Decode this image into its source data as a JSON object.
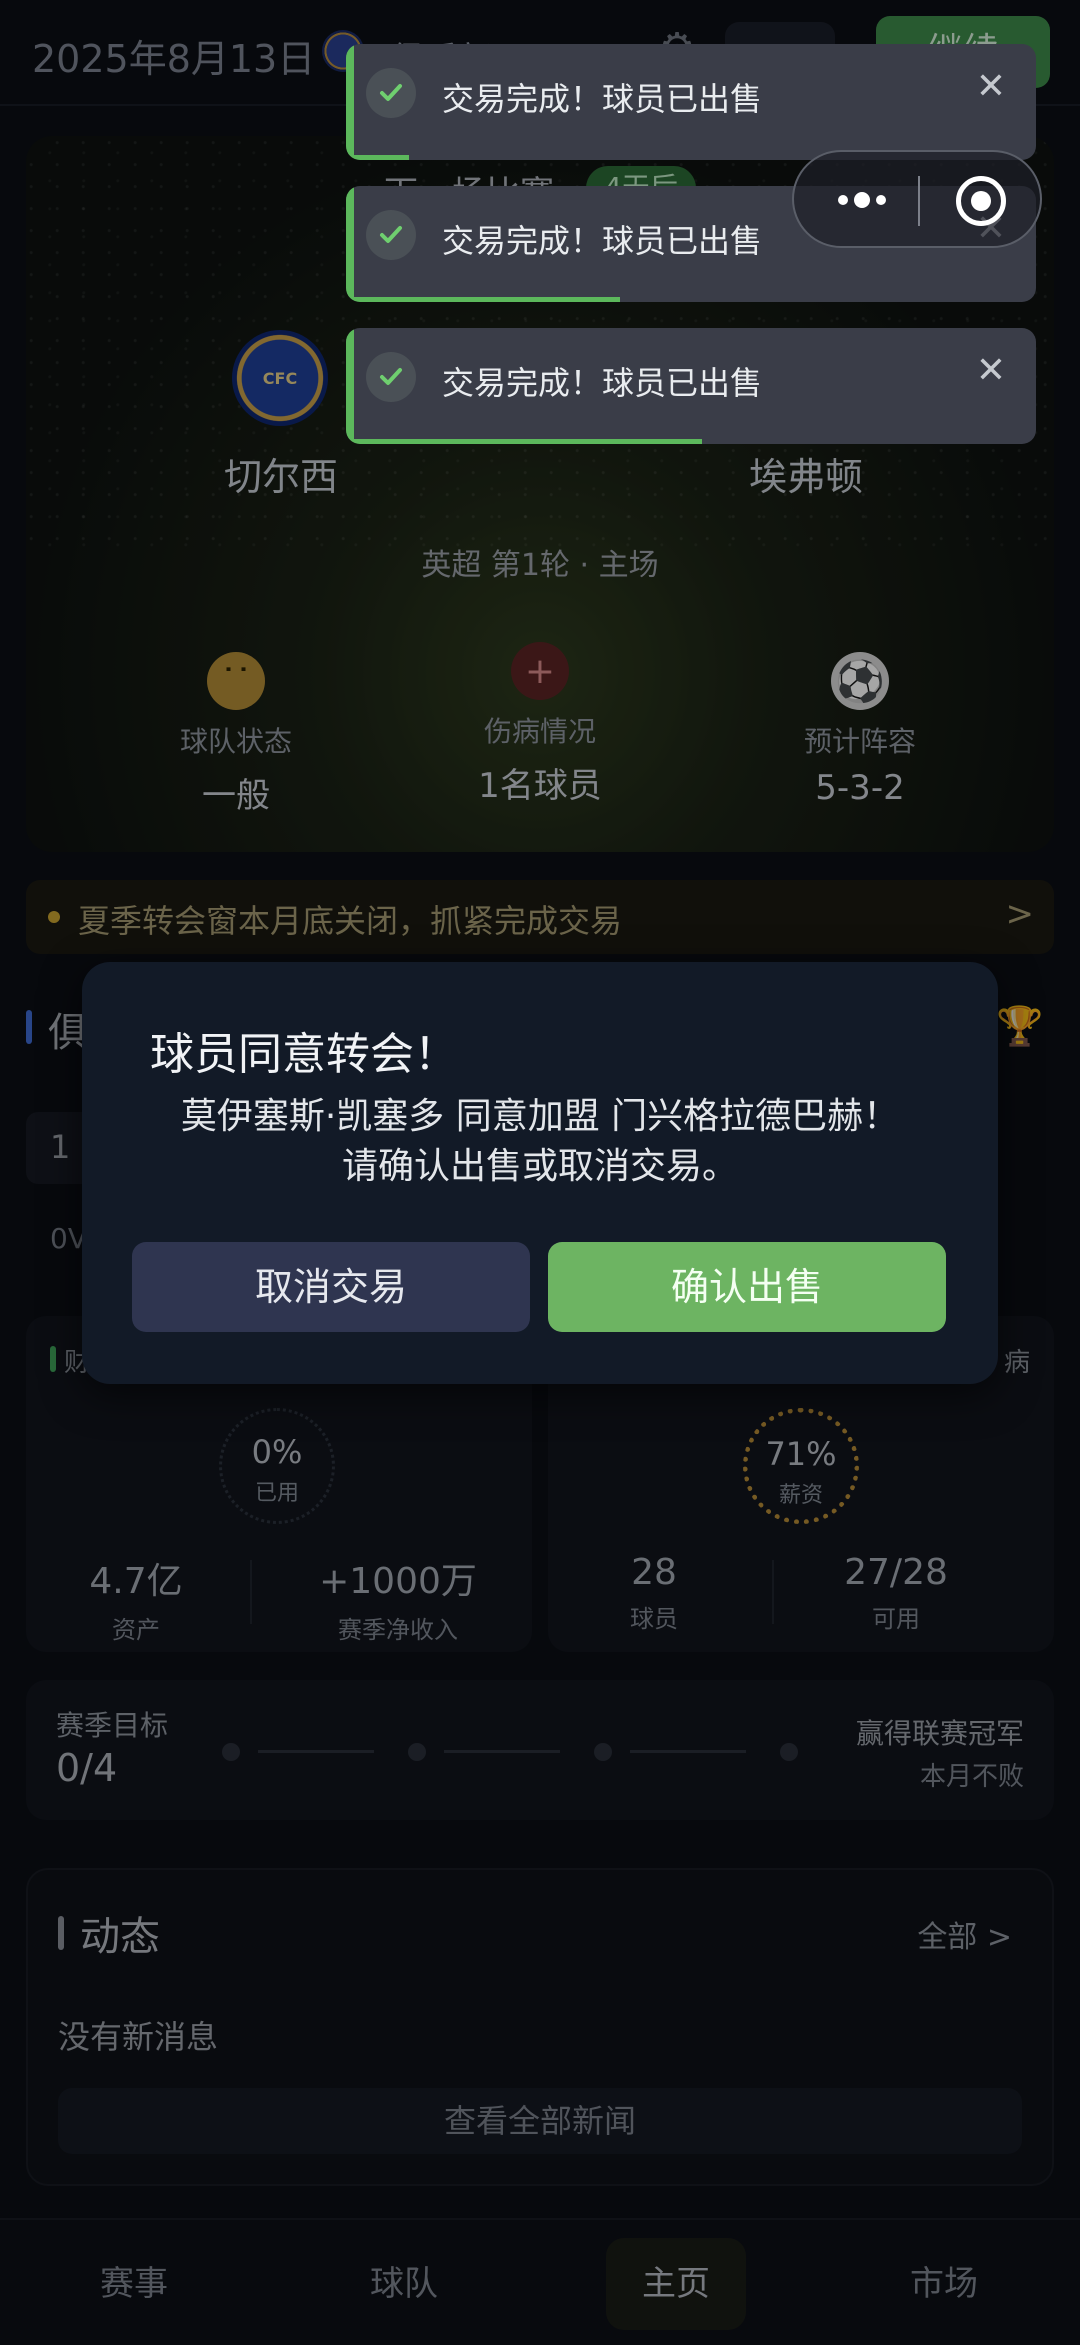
{
  "topbar": {
    "date": "2025年8月13日",
    "club_name": "俱乐部",
    "continue_label": "继续"
  },
  "match": {
    "next_label": "下一场比赛",
    "days_badge": "4天后",
    "home_team": "切尔西",
    "away_team": "埃弗顿",
    "info": "英超 第1轮  ·  主场",
    "stats": [
      {
        "icon": "neutral-face-icon",
        "label": "球队状态",
        "value": "一般"
      },
      {
        "icon": "injury-plus-icon",
        "label": "伤病情况",
        "value": "1名球员"
      },
      {
        "icon": "soccer-ball-icon",
        "label": "预计阵容",
        "value": "5-3-2"
      }
    ]
  },
  "notice": {
    "text": "夏季转会窗本月底关闭，抓紧完成交易",
    "chevron": ">"
  },
  "club_section": {
    "title_fragment": "俱",
    "row_fragment": "1",
    "ov_fragment": "0V"
  },
  "finance": {
    "title_fragment": "财",
    "ring_pct": "0%",
    "ring_caption": "已用",
    "metrics": [
      {
        "value": "4.7亿",
        "label": "资产"
      },
      {
        "value": "+1000万",
        "label": "赛季净收入"
      }
    ]
  },
  "squad": {
    "title_fragment": "病",
    "ring_pct": "71%",
    "ring_caption": "薪资",
    "metrics": [
      {
        "value": "28",
        "label": "球员"
      },
      {
        "value": "27/28",
        "label": "可用"
      }
    ]
  },
  "goals": {
    "label": "赛季目标",
    "value": "0/4",
    "right_primary": "赢得联赛冠军",
    "right_secondary": "本月不败"
  },
  "news": {
    "title": "动态",
    "all_link": "全部 >",
    "empty_text": "没有新消息",
    "view_all": "查看全部新闻"
  },
  "bottom_nav": [
    {
      "label": "赛事",
      "active": false
    },
    {
      "label": "球队",
      "active": false
    },
    {
      "label": "主页",
      "active": true
    },
    {
      "label": "市场",
      "active": false
    }
  ],
  "toasts": [
    {
      "message": "交易完成！球员已出售",
      "close": "✕",
      "progress": 0.08
    },
    {
      "message": "交易完成！球员已出售",
      "close": "✕",
      "progress": 0.39
    },
    {
      "message": "交易完成！球员已出售",
      "close": "✕",
      "progress": 0.51
    }
  ],
  "dialog": {
    "title": "球员同意转会！",
    "body_line1": "莫伊塞斯·凯塞多 同意加盟 门兴格拉德巴赫！",
    "body_line2": "请确认出售或取消交易。",
    "cancel_label": "取消交易",
    "confirm_label": "确认出售"
  },
  "colors": {
    "accent_green": "#6db462",
    "toast_bg": "#3a3d48",
    "dialog_bg": "#121a27",
    "cancel_btn": "#2f3550"
  }
}
